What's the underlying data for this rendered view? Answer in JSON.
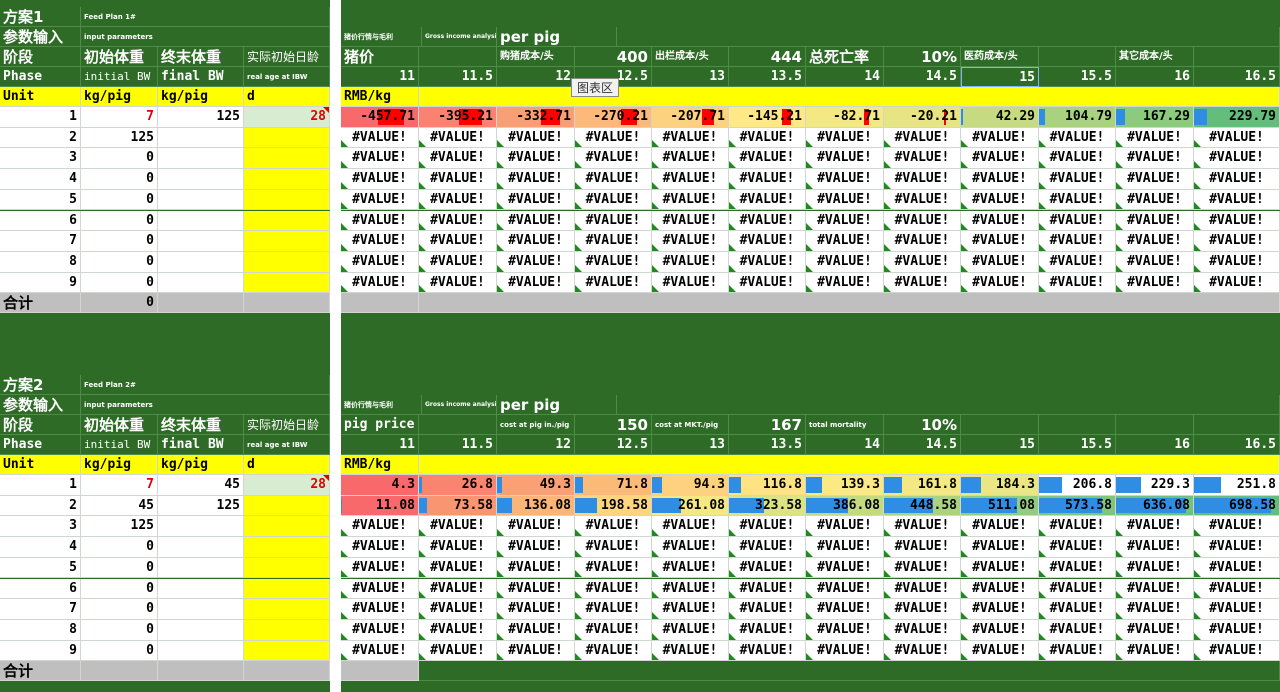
{
  "tooltip": "图表区",
  "columns": [
    "11",
    "11.5",
    "12",
    "12.5",
    "13",
    "13.5",
    "14",
    "14.5",
    "15",
    "15.5",
    "16",
    "16.5"
  ],
  "plans": [
    {
      "title": "方案1",
      "subtitle": "Feed Plan 1#",
      "param_label": "参数输入",
      "param_sub": "input parameters",
      "gross_label": "猪价行情与毛利",
      "gross_sub": "Gross income analysis",
      "per_pig": "per pig",
      "head": {
        "phase_cn": "阶段",
        "initbw_cn": "初始体重",
        "finalbw_cn": "终末体重",
        "realage_cn": "实际初始日龄",
        "phase_en": "Phase",
        "initbw_en": "initial BW",
        "finalbw_en": "final BW",
        "realage_en": "real age at IBW",
        "unit": "Unit",
        "initbw_unit": "kg/pig",
        "finalbw_unit": "kg/pig",
        "realage_unit": "d"
      },
      "header_items": [
        {
          "text": "猪价",
          "cls": "big"
        },
        {
          "text": "",
          "cls": ""
        },
        {
          "text": "购猪成本/头",
          "cls": "sm"
        },
        {
          "text": "400",
          "cls": "big r"
        },
        {
          "text": "出栏成本/头",
          "cls": "sm"
        },
        {
          "text": "444",
          "cls": "big r"
        },
        {
          "text": "总死亡率",
          "cls": "big"
        },
        {
          "text": "10%",
          "cls": "big r"
        },
        {
          "text": "医药成本/头",
          "cls": "sm"
        },
        {
          "text": "",
          "cls": ""
        },
        {
          "text": "其它成本/头",
          "cls": "sm"
        },
        {
          "text": "",
          "cls": ""
        }
      ],
      "unit_text": "RMB/kg",
      "rows": [
        {
          "idx": "1",
          "init": "7",
          "final": "125",
          "age": "28"
        },
        {
          "idx": "2",
          "init": "125",
          "final": "",
          "age": ""
        },
        {
          "idx": "3",
          "init": "0",
          "final": "",
          "age": ""
        },
        {
          "idx": "4",
          "init": "0",
          "final": "",
          "age": ""
        },
        {
          "idx": "5",
          "init": "0",
          "final": "",
          "age": ""
        },
        {
          "idx": "6",
          "init": "0",
          "final": "",
          "age": ""
        },
        {
          "idx": "7",
          "init": "0",
          "final": "",
          "age": ""
        },
        {
          "idx": "8",
          "init": "0",
          "final": "",
          "age": ""
        },
        {
          "idx": "9",
          "init": "0",
          "final": "",
          "age": ""
        }
      ],
      "value_rows": [
        [
          {
            "v": "-457.71",
            "bg": "#f8696b",
            "bar": "neg",
            "frac": 0.33
          },
          {
            "v": "-395.21",
            "bg": "#f98370",
            "bar": "neg",
            "frac": 0.29
          },
          {
            "v": "-332.71",
            "bg": "#fa9e75",
            "bar": "neg",
            "frac": 0.24
          },
          {
            "v": "-270.21",
            "bg": "#fcb979",
            "bar": "neg",
            "frac": 0.2
          },
          {
            "v": "-207.71",
            "bg": "#fdd27e",
            "bar": "neg",
            "frac": 0.15
          },
          {
            "v": "-145.21",
            "bg": "#ffe984",
            "bar": "neg",
            "frac": 0.11
          },
          {
            "v": "-82.71",
            "bg": "#f4e883",
            "bar": "neg",
            "frac": 0.06
          },
          {
            "v": "-20.21",
            "bg": "#e6e483",
            "bar": "neg",
            "frac": 0.015
          },
          {
            "v": "42.29",
            "bg": "#c6db81",
            "bar": "pos",
            "frac": 0.03
          },
          {
            "v": "104.79",
            "bg": "#a9d27f",
            "bar": "pos",
            "frac": 0.08
          },
          {
            "v": "167.29",
            "bg": "#8cca7d",
            "bar": "pos",
            "frac": 0.12
          },
          {
            "v": "229.79",
            "bg": "#63be7b",
            "bar": "pos",
            "frac": 0.17
          }
        ]
      ],
      "error_text": "#VALUE!",
      "error_rows": 8,
      "total_label": "合计",
      "total_value": "0"
    },
    {
      "title": "方案2",
      "subtitle": "Feed Plan 2#",
      "param_label": "参数输入",
      "param_sub": "input parameters",
      "gross_label": "猪价行情与毛利",
      "gross_sub": "Gross income analysis",
      "per_pig": "per pig",
      "head": {
        "phase_cn": "阶段",
        "initbw_cn": "初始体重",
        "finalbw_cn": "终末体重",
        "realage_cn": "实际初始日龄",
        "phase_en": "Phase",
        "initbw_en": "initial BW",
        "finalbw_en": "final BW",
        "realage_en": "real age at IBW",
        "unit": "Unit",
        "initbw_unit": "kg/pig",
        "finalbw_unit": "kg/pig",
        "realage_unit": "d"
      },
      "header_items": [
        {
          "text": "pig price",
          "cls": "b"
        },
        {
          "text": "",
          "cls": ""
        },
        {
          "text": "cost at pig in./pig",
          "cls": "tiny"
        },
        {
          "text": "150",
          "cls": "big r"
        },
        {
          "text": "cost at MKT./pig",
          "cls": "tiny"
        },
        {
          "text": "167",
          "cls": "big r"
        },
        {
          "text": "total mortality",
          "cls": "tiny"
        },
        {
          "text": "10%",
          "cls": "big r"
        },
        {
          "text": "",
          "cls": ""
        },
        {
          "text": "",
          "cls": ""
        },
        {
          "text": "",
          "cls": ""
        },
        {
          "text": "",
          "cls": ""
        }
      ],
      "unit_text": "RMB/kg",
      "rows": [
        {
          "idx": "1",
          "init": "7",
          "final": "45",
          "age": "28"
        },
        {
          "idx": "2",
          "init": "45",
          "final": "125",
          "age": ""
        },
        {
          "idx": "3",
          "init": "125",
          "final": "",
          "age": ""
        },
        {
          "idx": "4",
          "init": "0",
          "final": "",
          "age": ""
        },
        {
          "idx": "5",
          "init": "0",
          "final": "",
          "age": ""
        },
        {
          "idx": "6",
          "init": "0",
          "final": "",
          "age": ""
        },
        {
          "idx": "7",
          "init": "0",
          "final": "",
          "age": ""
        },
        {
          "idx": "8",
          "init": "0",
          "final": "",
          "age": ""
        },
        {
          "idx": "9",
          "init": "0",
          "final": "",
          "age": ""
        }
      ],
      "value_rows": [
        [
          {
            "v": "4.3",
            "bg": "#f8696b",
            "bar": "pos",
            "frac": 0.0
          },
          {
            "v": "26.8",
            "bg": "#f98570",
            "bar": "pos",
            "frac": 0.04
          },
          {
            "v": "49.3",
            "bg": "#faa074",
            "bar": "pos",
            "frac": 0.07
          },
          {
            "v": "71.8",
            "bg": "#fcba79",
            "bar": "pos",
            "frac": 0.1
          },
          {
            "v": "94.3",
            "bg": "#fdd17e",
            "bar": "pos",
            "frac": 0.13
          },
          {
            "v": "116.8",
            "bg": "#fee382",
            "bar": "pos",
            "frac": 0.16
          },
          {
            "v": "139.3",
            "bg": "#fbe983",
            "bar": "pos",
            "frac": 0.2
          },
          {
            "v": "161.8",
            "bg": "#f3e884",
            "bar": "pos",
            "frac": 0.23
          },
          {
            "v": "184.3",
            "bg": "#ebe684",
            "bar": "pos",
            "frac": 0.26
          },
          {
            "v": "206.8",
            "bg": "#fff",
            "bar": "pos",
            "frac": 0.29
          },
          {
            "v": "229.3",
            "bg": "#fff",
            "bar": "pos",
            "frac": 0.32
          },
          {
            "v": "251.8",
            "bg": "#fff",
            "bar": "pos",
            "frac": 0.35
          }
        ],
        [
          {
            "v": "11.08",
            "bg": "#f8696b",
            "bar": "pos",
            "frac": 0.01
          },
          {
            "v": "73.58",
            "bg": "#f99571",
            "bar": "pos",
            "frac": 0.1
          },
          {
            "v": "136.08",
            "bg": "#fbb578",
            "bar": "pos",
            "frac": 0.19
          },
          {
            "v": "198.58",
            "bg": "#fdd57f",
            "bar": "pos",
            "frac": 0.28
          },
          {
            "v": "261.08",
            "bg": "#f5e884",
            "bar": "pos",
            "frac": 0.37
          },
          {
            "v": "323.58",
            "bg": "#dde283",
            "bar": "pos",
            "frac": 0.45
          },
          {
            "v": "386.08",
            "bg": "#c3da81",
            "bar": "pos",
            "frac": 0.54
          },
          {
            "v": "448.58",
            "bg": "#aad27f",
            "bar": "pos",
            "frac": 0.63
          },
          {
            "v": "511.08",
            "bg": "#94cc7e",
            "bar": "pos",
            "frac": 0.72
          },
          {
            "v": "573.58",
            "bg": "#7fc67d",
            "bar": "pos",
            "frac": 0.81
          },
          {
            "v": "636.08",
            "bg": "#6fc27c",
            "bar": "pos",
            "frac": 0.9
          },
          {
            "v": "698.58",
            "bg": "#63be7b",
            "bar": "pos",
            "frac": 0.99
          }
        ]
      ],
      "error_text": "#VALUE!",
      "error_rows": 7,
      "total_label": "合计",
      "total_value": ""
    }
  ]
}
